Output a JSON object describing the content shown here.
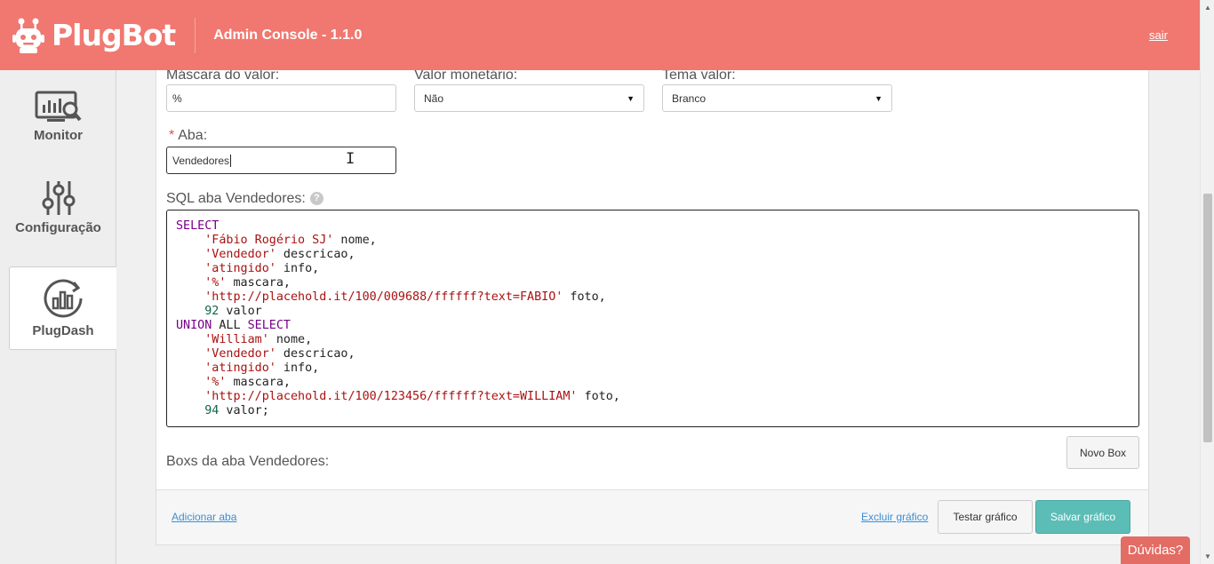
{
  "header": {
    "brand": "PlugBot",
    "title": "Admin Console - 1.1.0",
    "logout_label": "sair"
  },
  "sidebar": {
    "items": [
      {
        "label": "Monitor",
        "icon": "monitor-chart-icon"
      },
      {
        "label": "Configuração",
        "icon": "sliders-icon"
      },
      {
        "label": "PlugDash",
        "icon": "dashboard-chart-icon"
      }
    ],
    "active": "PlugDash"
  },
  "form": {
    "mascara": {
      "label": "Máscara do valor:",
      "value": "%"
    },
    "monetario": {
      "label": "Valor monetário:",
      "value": "Não"
    },
    "tema": {
      "label": "Tema valor:",
      "value": "Branco"
    },
    "aba": {
      "required_mark": "*",
      "label": "Aba:",
      "value": "Vendedores"
    },
    "sql": {
      "label": "SQL aba Vendedores:",
      "help": "?"
    },
    "boxs_label": "Boxs da aba Vendedores:"
  },
  "sql_lines": [
    [
      [
        "kw",
        "SELECT"
      ]
    ],
    [
      [
        "plain",
        "    "
      ],
      [
        "str",
        "'Fábio Rogério SJ'"
      ],
      [
        "plain",
        " nome,"
      ]
    ],
    [
      [
        "plain",
        "    "
      ],
      [
        "str",
        "'Vendedor'"
      ],
      [
        "plain",
        " descricao,"
      ]
    ],
    [
      [
        "plain",
        "    "
      ],
      [
        "str",
        "'atingido'"
      ],
      [
        "plain",
        " info,"
      ]
    ],
    [
      [
        "plain",
        "    "
      ],
      [
        "str",
        "'%'"
      ],
      [
        "plain",
        " mascara,"
      ]
    ],
    [
      [
        "plain",
        "    "
      ],
      [
        "str",
        "'http://placehold.it/100/009688/ffffff?text=FABIO'"
      ],
      [
        "plain",
        " foto,"
      ]
    ],
    [
      [
        "plain",
        "    "
      ],
      [
        "num",
        "92"
      ],
      [
        "plain",
        " valor"
      ]
    ],
    [
      [
        "kw",
        "UNION"
      ],
      [
        "plain",
        " ALL "
      ],
      [
        "kw",
        "SELECT"
      ]
    ],
    [
      [
        "plain",
        "    "
      ],
      [
        "str",
        "'William'"
      ],
      [
        "plain",
        " nome,"
      ]
    ],
    [
      [
        "plain",
        "    "
      ],
      [
        "str",
        "'Vendedor'"
      ],
      [
        "plain",
        " descricao,"
      ]
    ],
    [
      [
        "plain",
        "    "
      ],
      [
        "str",
        "'atingido'"
      ],
      [
        "plain",
        " info,"
      ]
    ],
    [
      [
        "plain",
        "    "
      ],
      [
        "str",
        "'%'"
      ],
      [
        "plain",
        " mascara,"
      ]
    ],
    [
      [
        "plain",
        "    "
      ],
      [
        "str",
        "'http://placehold.it/100/123456/ffffff?text=WILLIAM'"
      ],
      [
        "plain",
        " foto,"
      ]
    ],
    [
      [
        "plain",
        "    "
      ],
      [
        "num",
        "94"
      ],
      [
        "plain",
        " valor;"
      ]
    ]
  ],
  "buttons": {
    "novo_box": "Novo Box",
    "adicionar_aba": "Adicionar aba",
    "excluir": "Excluir gráfico",
    "testar": "Testar gráfico",
    "salvar": "Salvar gráfico",
    "duvidas": "Dúvidas?"
  },
  "colors": {
    "header": "#f07870",
    "primary_button": "#5bbdb6",
    "link": "#3a8fd8",
    "help_tab": "#e36c64"
  }
}
